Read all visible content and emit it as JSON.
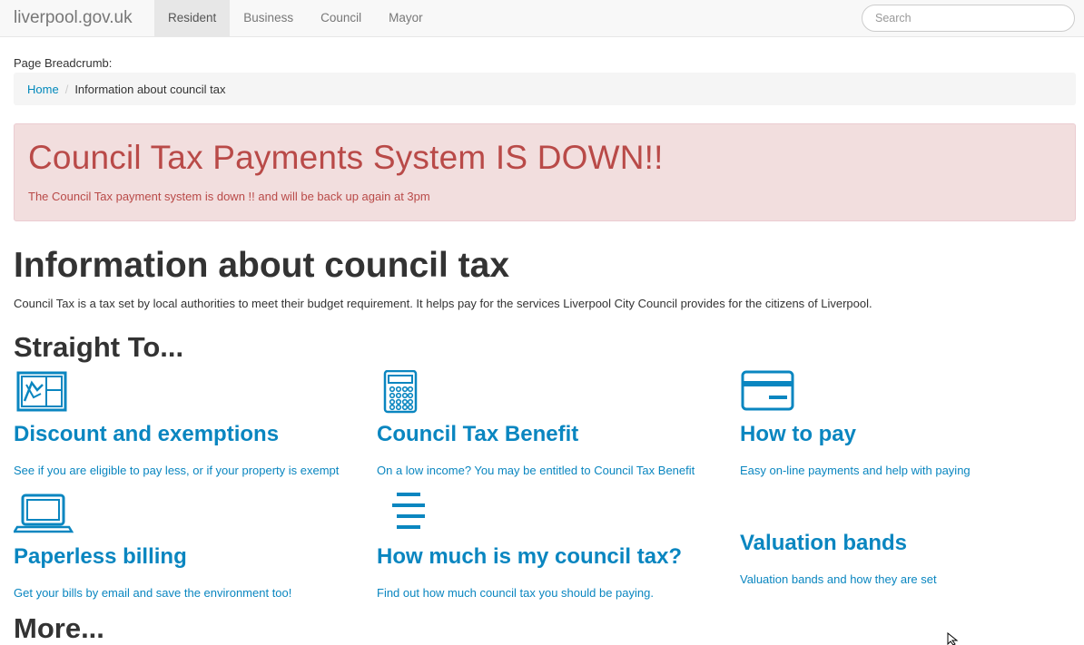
{
  "navbar": {
    "brand": "liverpool.gov.uk",
    "items": [
      {
        "label": "Resident",
        "active": true
      },
      {
        "label": "Business",
        "active": false
      },
      {
        "label": "Council",
        "active": false
      },
      {
        "label": "Mayor",
        "active": false
      }
    ],
    "search_placeholder": "Search"
  },
  "breadcrumb": {
    "label": "Page Breadcrumb:",
    "home": "Home",
    "current": "Information about council tax"
  },
  "alert": {
    "title": "Council Tax Payments System IS DOWN!!",
    "message": "The Council Tax payment system is down !! and will be back up again at 3pm"
  },
  "main": {
    "title": "Information about council tax",
    "intro": "Council Tax is a tax set by local authorities to meet their budget requirement. It helps pay for the services Liverpool City Council provides for the citizens of Liverpool.",
    "straight_to": "Straight To...",
    "more": "More..."
  },
  "tiles": [
    {
      "title": "Discount and exemptions",
      "desc": "See if you are eligible to pay less, or if your property is exempt",
      "icon": "floorplan-icon"
    },
    {
      "title": "Council Tax Benefit",
      "desc": "On a low income? You may be entitled to Council Tax Benefit",
      "icon": "calculator-icon"
    },
    {
      "title": "How to pay",
      "desc": "Easy on-line payments and help with paying",
      "icon": "credit-card-icon"
    },
    {
      "title": "Paperless billing",
      "desc": "Get your bills by email and save the environment too!",
      "icon": "laptop-icon"
    },
    {
      "title": "How much is my council tax?",
      "desc": "Find out how much council tax you should be paying.",
      "icon": "list-icon"
    },
    {
      "title": "Valuation bands",
      "desc": "Valuation bands and how they are set",
      "icon": ""
    }
  ],
  "colors": {
    "link": "#0a86c0",
    "alert_text": "#b94a48",
    "alert_bg": "#f2dede"
  }
}
